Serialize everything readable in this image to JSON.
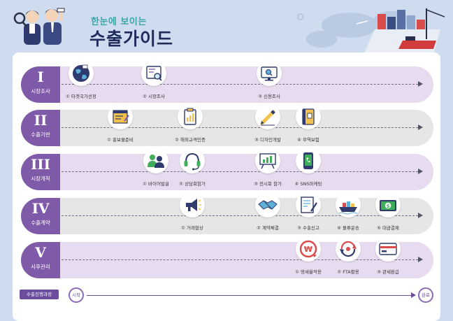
{
  "header": {
    "subtitle": "한눈에 보이는",
    "title": "수출가이드"
  },
  "colors": {
    "tab": "#7f5aa9",
    "row_purple": "#e7dcef",
    "row_gray": "#e6e6e6",
    "title": "#1e2b5c",
    "subtitle": "#3aa7a5"
  },
  "stages": [
    {
      "numeral": "I",
      "label": "시장조사",
      "variant": "purple",
      "steps": [
        {
          "label": "① 타겟국가선정",
          "icon": "globe-icon"
        },
        {
          "label": "② 시장조사",
          "icon": "magnifier-screen-icon"
        },
        {
          "label": "③ 신용조사",
          "icon": "monitor-search-icon"
        }
      ]
    },
    {
      "numeral": "II",
      "label": "수출기반",
      "variant": "gray",
      "steps": [
        {
          "label": "① 홍보물준비",
          "icon": "brochure-icon"
        },
        {
          "label": "② 해외규격인증",
          "icon": "certificate-clipboard-icon"
        },
        {
          "label": "③ 디자인개발",
          "icon": "pencil-icon"
        },
        {
          "label": "④ 무역보험",
          "icon": "insurance-book-icon"
        }
      ]
    },
    {
      "numeral": "III",
      "label": "시장개척",
      "variant": "purple",
      "steps": [
        {
          "label": "① 바이어발굴",
          "icon": "buyer-people-icon"
        },
        {
          "label": "② 상담회참가",
          "icon": "headset-icon"
        },
        {
          "label": "③ 전시회 참가",
          "icon": "exhibition-board-icon"
        },
        {
          "label": "④ SNS마케팅",
          "icon": "smartphone-icon"
        }
      ]
    },
    {
      "numeral": "IV",
      "label": "수출계약",
      "variant": "gray",
      "steps": [
        {
          "label": "① 거래협상",
          "icon": "megaphone-icon"
        },
        {
          "label": "② 계약체결",
          "icon": "handshake-icon"
        },
        {
          "label": "③ 수출신고",
          "icon": "document-pen-icon"
        },
        {
          "label": "④ 물류운송",
          "icon": "cargo-ship-icon"
        },
        {
          "label": "⑤ 대금결제",
          "icon": "dollar-wallet-icon"
        }
      ]
    },
    {
      "numeral": "V",
      "label": "사후관리",
      "variant": "purple",
      "steps": [
        {
          "label": "① 영세율적용",
          "icon": "won-coin-icon"
        },
        {
          "label": "② FTA활용",
          "icon": "fta-cycle-icon"
        },
        {
          "label": "③ 관세환급",
          "icon": "credit-card-icon"
        }
      ]
    }
  ],
  "progress": {
    "label": "수출진행과정",
    "start": "시작",
    "end": "완료"
  }
}
